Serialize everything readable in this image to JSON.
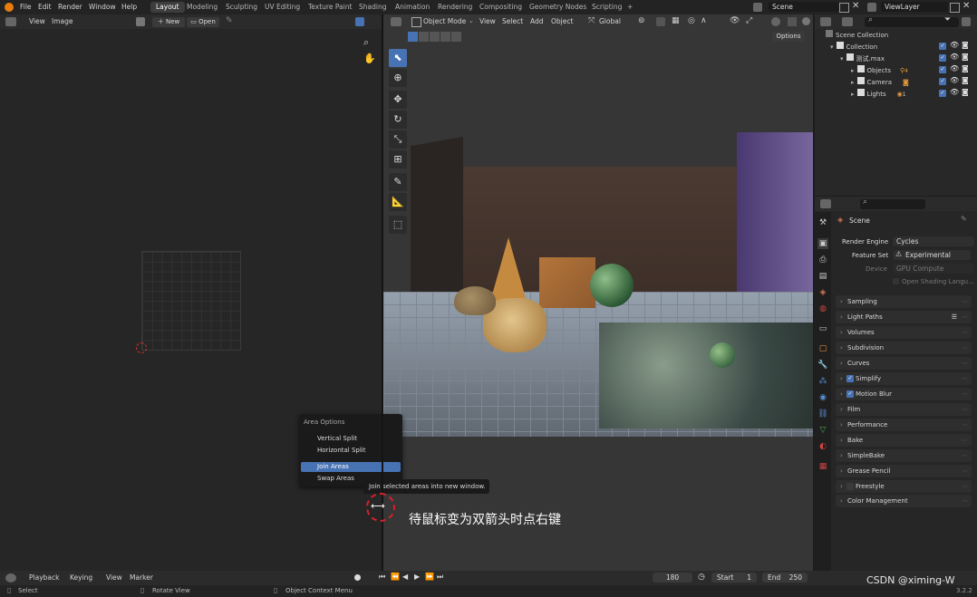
{
  "topbar": {
    "menus": [
      "File",
      "Edit",
      "Render",
      "Window",
      "Help"
    ],
    "workspaces": [
      "Layout",
      "Modeling",
      "Sculpting",
      "UV Editing",
      "Texture Paint",
      "Shading",
      "Animation",
      "Rendering",
      "Compositing",
      "Geometry Nodes",
      "Scripting",
      "+"
    ],
    "active_workspace": "Layout",
    "scene_field": "Scene",
    "viewlayer_field": "ViewLayer"
  },
  "image_editor": {
    "menus": [
      "View",
      "Image"
    ],
    "new_label": "New",
    "open_label": "Open"
  },
  "viewport": {
    "mode": "Object Mode",
    "menus": [
      "View",
      "Select",
      "Add",
      "Object"
    ],
    "transform_orientation": "Global",
    "options_label": "Options",
    "scene_labels": {
      "sphere": "",
      "cube": ""
    }
  },
  "context_menu": {
    "title": "Area Options",
    "items": [
      "Vertical Split",
      "Horizontal Split",
      "Join Areas",
      "Swap Areas"
    ],
    "active_index": 2,
    "tooltip": "Join selected areas into new window."
  },
  "annotation": "待鼠标变为双箭头时点右键",
  "outliner": {
    "rows": [
      {
        "label": "Scene Collection"
      },
      {
        "label": "Collection"
      },
      {
        "label": "测试.max"
      },
      {
        "label": "Objects",
        "badge": "4"
      },
      {
        "label": "Camera"
      },
      {
        "label": "Lights",
        "badge": "1"
      }
    ]
  },
  "properties": {
    "scene_label": "Scene",
    "render_engine_label": "Render Engine",
    "render_engine_value": "Cycles",
    "feature_set_label": "Feature Set",
    "feature_set_value": "Experimental",
    "device_label": "Device",
    "device_value": "GPU Compute",
    "osl_label": "Open Shading Langu...",
    "panels": [
      {
        "label": "Sampling",
        "checkbox": false
      },
      {
        "label": "Light Paths",
        "checkbox": false
      },
      {
        "label": "Volumes",
        "checkbox": false
      },
      {
        "label": "Subdivision",
        "checkbox": false
      },
      {
        "label": "Curves",
        "checkbox": false
      },
      {
        "label": "Simplify",
        "checkbox": true
      },
      {
        "label": "Motion Blur",
        "checkbox": true
      },
      {
        "label": "Film",
        "checkbox": false
      },
      {
        "label": "Performance",
        "checkbox": false
      },
      {
        "label": "Bake",
        "checkbox": false
      },
      {
        "label": "SimpleBake",
        "checkbox": false
      },
      {
        "label": "Grease Pencil",
        "checkbox": false
      },
      {
        "label": "Freestyle",
        "checkbox": false
      },
      {
        "label": "Color Management",
        "checkbox": false
      }
    ]
  },
  "timeline": {
    "menus": [
      "Playback",
      "Keying",
      "View",
      "Marker"
    ],
    "current_frame": "180",
    "start_label": "Start",
    "start_value": "1",
    "end_label": "End",
    "end_value": "250"
  },
  "statusbar": {
    "items": [
      "Select",
      "Rotate View",
      "Object Context Menu"
    ],
    "version": "3.2.2",
    "watermark": "CSDN @ximing-W"
  },
  "colors": {
    "accent": "#4772b3",
    "annotation_circle": "#d6202a"
  }
}
